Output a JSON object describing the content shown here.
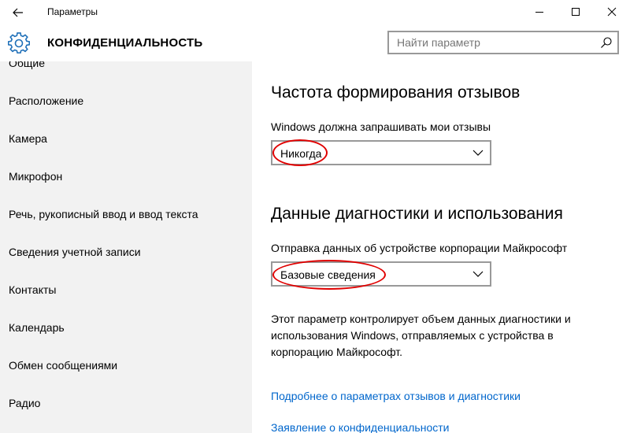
{
  "window": {
    "title": "Параметры"
  },
  "header": {
    "section_title": "КОНФИДЕНЦИАЛЬНОСТЬ",
    "search_placeholder": "Найти параметр"
  },
  "sidebar": {
    "items": [
      {
        "label": "Общие"
      },
      {
        "label": "Расположение"
      },
      {
        "label": "Камера"
      },
      {
        "label": "Микрофон"
      },
      {
        "label": "Речь, рукописный ввод и ввод текста"
      },
      {
        "label": "Сведения учетной записи"
      },
      {
        "label": "Контакты"
      },
      {
        "label": "Календарь"
      },
      {
        "label": "Обмен сообщениями"
      },
      {
        "label": "Радио"
      }
    ]
  },
  "main": {
    "feedback": {
      "heading": "Частота формирования отзывов",
      "label": "Windows должна запрашивать мои отзывы",
      "selected": "Никогда"
    },
    "diagnostics": {
      "heading": "Данные диагностики и использования",
      "label": "Отправка данных об устройстве корпорации Майкрософт",
      "selected": "Базовые сведения",
      "description": "Этот параметр контролирует объем данных диагностики и использования Windows, отправляемых с устройства в корпорацию Майкрософт."
    },
    "links": {
      "more_info": "Подробнее о параметрах отзывов и диагностики",
      "privacy_statement": "Заявление о конфиденциальности"
    }
  },
  "colors": {
    "sidebar_bg": "#f2f2f2",
    "link": "#0066cc",
    "highlight": "#e00000",
    "control_border": "#999999"
  },
  "icons": [
    "back-arrow-icon",
    "minimize-icon",
    "maximize-icon",
    "close-icon",
    "gear-icon",
    "search-icon",
    "chevron-down-icon"
  ]
}
